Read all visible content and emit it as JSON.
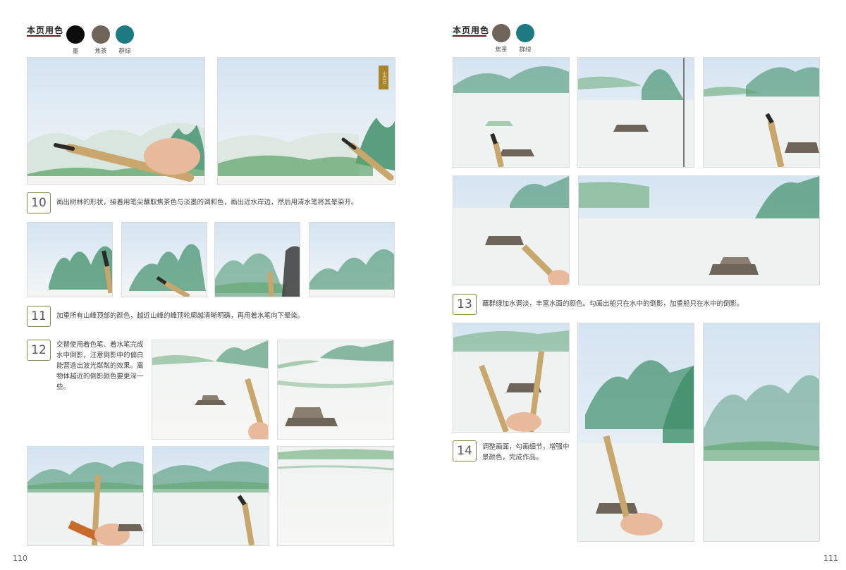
{
  "left_page": {
    "page_number": "110",
    "header": {
      "title": "本页用色"
    },
    "swatches": [
      {
        "label": "墨",
        "color": "#0d0d0d"
      },
      {
        "label": "焦茶",
        "color": "#6f6458"
      },
      {
        "label": "群绿",
        "color": "#1c7a80"
      }
    ],
    "stamp_text": "小白云",
    "steps": [
      {
        "number": "10",
        "text": "画出树林的形状，接着用笔尖蘸取焦茶色与淡墨的调和色，画出近水岸边，然后用清水笔将其晕染开。"
      },
      {
        "number": "11",
        "text": "加重所有山峰顶部的颜色，越近山峰的峰顶轮廓越清晰明确，再用着水笔向下晕染。"
      },
      {
        "number": "12",
        "text": "交替使用着色笔、着水笔完成水中倒影，注意倒影中的偏白能营造出波光粼粼的效果。离物体越近的倒影颜色要更深一些。"
      }
    ]
  },
  "right_page": {
    "page_number": "111",
    "header": {
      "title": "本页用色"
    },
    "swatches": [
      {
        "label": "焦茶",
        "color": "#6f6458"
      },
      {
        "label": "群绿",
        "color": "#1c7a80"
      }
    ],
    "steps": [
      {
        "number": "13",
        "text": "蘸群绿加水调淡，丰富水面的颜色。勾画出船只在水中的倒影，加重船只在水中的倒影。"
      },
      {
        "number": "14",
        "text": "调整画面，勾画细节，增强中景颜色，完成作品。"
      }
    ]
  },
  "colors": {
    "accent_rule": "#6a1f1f",
    "step_border": "#7a8c4a",
    "mountain": "#3f8f6a",
    "trees": "#5da46a",
    "sky": "#cfe0ee",
    "brush_handle": "#c9a66b",
    "skin": "#e9b99c"
  }
}
